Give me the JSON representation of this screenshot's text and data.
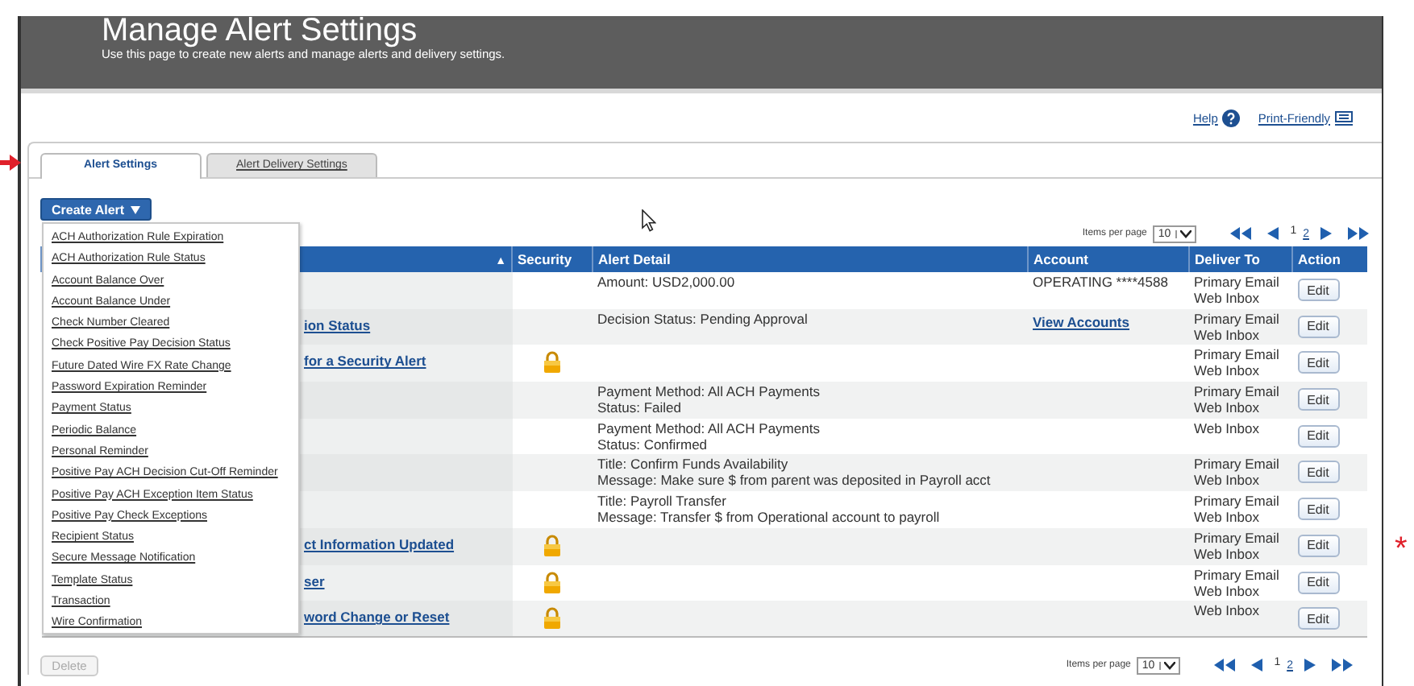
{
  "header": {
    "title": "Manage Alert Settings",
    "subtitle": "Use this page to create new alerts and manage alerts and delivery settings."
  },
  "links": [
    {
      "label": "Help",
      "kind": "help"
    },
    {
      "label": "Print-Friendly",
      "kind": "print"
    }
  ],
  "tabs": [
    {
      "label": "Alert Settings",
      "selected": true
    },
    {
      "label": "Alert Delivery Settings",
      "selected": false
    }
  ],
  "create_button": {
    "label": "Create Alert"
  },
  "create_menu": [
    "ACH Authorization Rule Expiration",
    "ACH Authorization Rule Status",
    "Account Balance Over",
    "Account Balance Under",
    "Check Number Cleared",
    "Check Positive Pay Decision Status",
    "Future Dated Wire FX Rate Change",
    "Password Expiration Reminder",
    "Payment Status",
    "Periodic Balance",
    "Personal Reminder",
    "Positive Pay ACH Decision Cut-Off Reminder",
    "Positive Pay ACH Exception Item Status",
    "Positive Pay Check Exceptions",
    "Recipient Status",
    "Secure Message Notification",
    "Template Status",
    "Transaction",
    "Wire Confirmation"
  ],
  "pager_top": {
    "label": "Items per page",
    "value": "10",
    "pages": [
      {
        "label": "1",
        "selected": true
      },
      {
        "label": "2",
        "selected": false
      }
    ]
  },
  "table": {
    "sort_mark": "▲",
    "columns": [
      "Security",
      "Alert Detail",
      "Account",
      "Deliver To",
      "Action"
    ],
    "rows": [
      {
        "name": "",
        "secured": false,
        "detail": [
          "Amount: USD2,000.00"
        ],
        "account": {
          "text": "OPERATING ****4588",
          "kind": "text"
        },
        "deliver": [
          "Primary Email",
          "Web Inbox"
        ],
        "action": "Edit"
      },
      {
        "name": "ion Status",
        "secured": false,
        "detail": [
          "Decision Status: Pending Approval"
        ],
        "account": {
          "text": "View Accounts",
          "kind": "link"
        },
        "deliver": [
          "Primary Email",
          "Web Inbox"
        ],
        "action": "Edit"
      },
      {
        "name": "for a Security Alert",
        "secured": true,
        "detail": [],
        "deliver": [
          "Primary Email",
          "Web Inbox"
        ],
        "action": "Edit"
      },
      {
        "name": "",
        "secured": false,
        "detail": [
          "Payment Method: All ACH Payments",
          "Status: Failed"
        ],
        "deliver": [
          "Primary Email",
          "Web Inbox"
        ],
        "action": "Edit"
      },
      {
        "name": "",
        "secured": false,
        "detail": [
          "Payment Method: All ACH Payments",
          "Status: Confirmed"
        ],
        "deliver": [
          "Web Inbox"
        ],
        "action": "Edit"
      },
      {
        "name": "",
        "secured": false,
        "detail": [
          "Title: Confirm Funds Availability",
          "Message: Make sure $ from parent was deposited in Payroll acct"
        ],
        "deliver": [
          "Primary Email",
          "Web Inbox"
        ],
        "action": "Edit"
      },
      {
        "name": "",
        "secured": false,
        "detail": [
          "Title: Payroll Transfer",
          "Message: Transfer $ from Operational account to payroll"
        ],
        "deliver": [
          "Primary Email",
          "Web Inbox"
        ],
        "action": "Edit"
      },
      {
        "name": "ct Information Updated",
        "secured": true,
        "detail": [],
        "deliver": [
          "Primary Email",
          "Web Inbox"
        ],
        "action": "Edit"
      },
      {
        "name": "ser",
        "secured": true,
        "detail": [],
        "deliver": [
          "Primary Email",
          "Web Inbox"
        ],
        "action": "Edit"
      },
      {
        "name": "word Change or Reset",
        "secured": true,
        "detail": [],
        "deliver": [
          "Web Inbox"
        ],
        "action": "Edit"
      }
    ]
  },
  "delete_button": {
    "label": "Delete",
    "disabled": true
  },
  "pager_bottom": {
    "label": "Items per page",
    "value": "10",
    "pages": [
      {
        "label": "1",
        "selected": true
      },
      {
        "label": "2",
        "selected": false
      }
    ]
  },
  "annotation": {
    "mark": "*"
  }
}
